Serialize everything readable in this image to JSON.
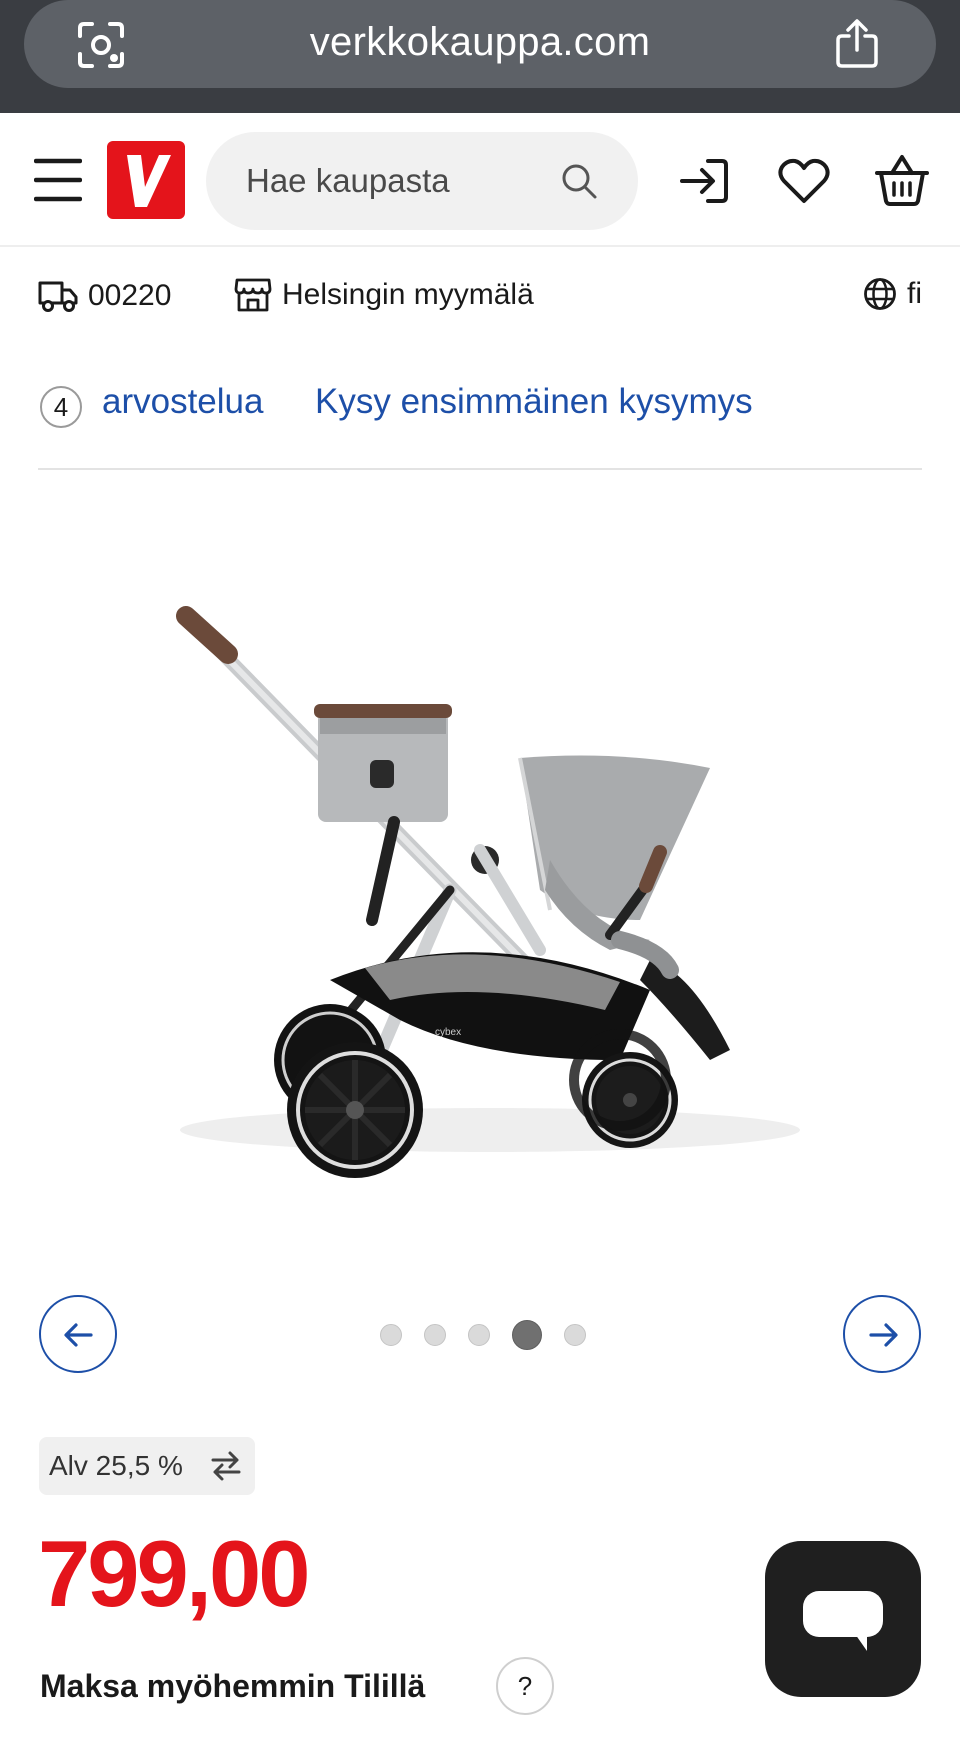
{
  "browser": {
    "url": "verkkokauppa.com",
    "lens_icon": "lens-icon",
    "share_icon": "share-icon"
  },
  "header": {
    "logo_letter": "V",
    "search_placeholder": "Hae kaupasta",
    "icons": [
      "menu-icon",
      "search-icon",
      "login-icon",
      "heart-icon",
      "basket-icon"
    ]
  },
  "info_bar": {
    "postcode": "00220",
    "store": "Helsingin myymälä",
    "language": "fi"
  },
  "reviews": {
    "count": "4",
    "reviews_label": "arvostelua",
    "ask_label": "Kysy ensimmäinen kysymys"
  },
  "carousel": {
    "total_images": 5,
    "active_index": 4
  },
  "price": {
    "vat_label": "Alv 25,5 %",
    "amount": "799,00",
    "paylater_label": "Maksa myöhemmin Tilillä",
    "help_label": "?"
  },
  "colors": {
    "brand_red": "#e4141b",
    "link_blue": "#1d4fa8",
    "browser_bar": "#3a3d42"
  }
}
